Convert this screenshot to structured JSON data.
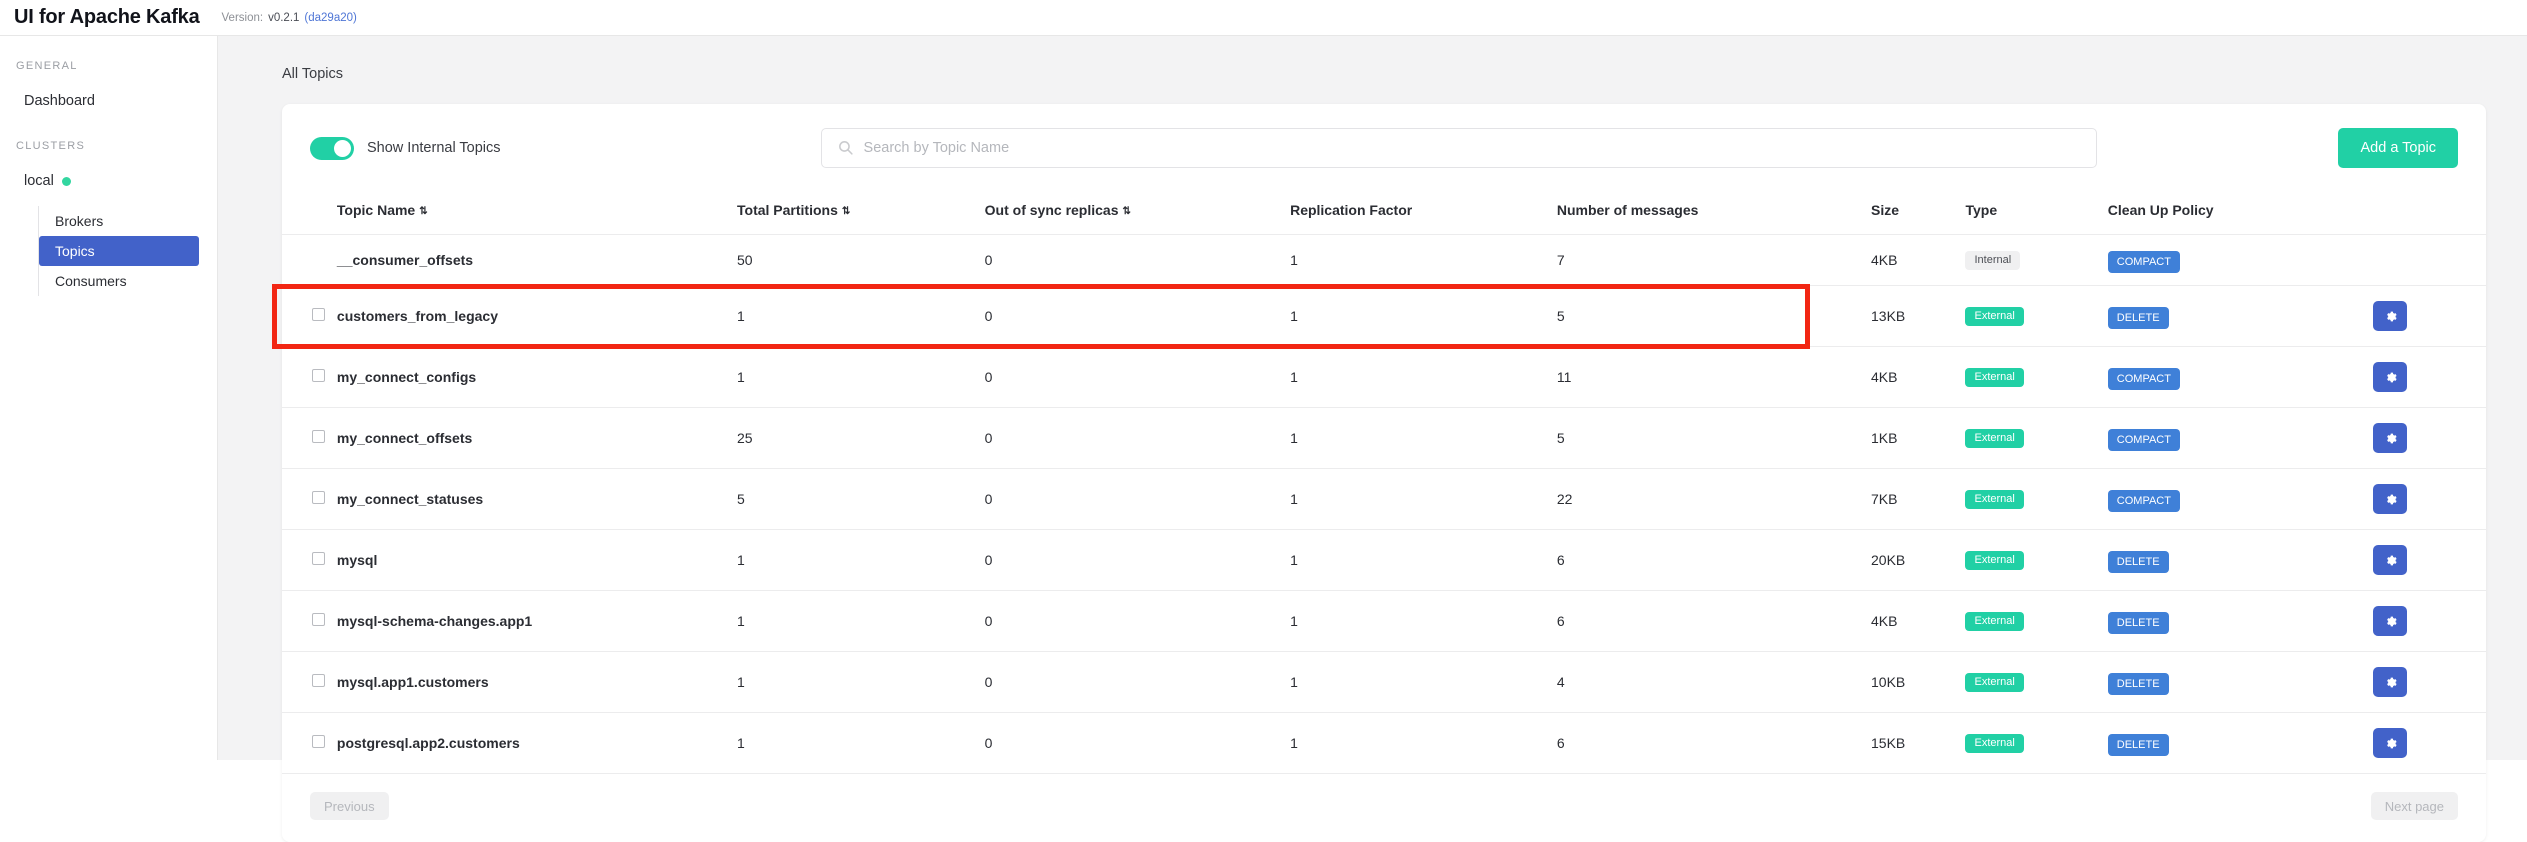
{
  "header": {
    "brand": "UI for Apache Kafka",
    "version_label": "Version:",
    "version_number": "v0.2.1",
    "version_hash": "(da29a20)"
  },
  "sidebar": {
    "general_heading": "GENERAL",
    "dashboard_label": "Dashboard",
    "clusters_heading": "CLUSTERS",
    "cluster_name": "local",
    "subnav": [
      {
        "label": "Brokers",
        "active": false
      },
      {
        "label": "Topics",
        "active": true
      },
      {
        "label": "Consumers",
        "active": false
      }
    ]
  },
  "main": {
    "page_title": "All Topics",
    "toggle_label": "Show Internal Topics",
    "toggle_on": true,
    "search_placeholder": "Search by Topic Name",
    "search_value": "",
    "add_topic_label": "Add a Topic",
    "previous_label": "Previous",
    "next_label": "Next page"
  },
  "table": {
    "columns": [
      "Topic Name",
      "Total Partitions",
      "Out of sync replicas",
      "Replication Factor",
      "Number of messages",
      "Size",
      "Type",
      "Clean Up Policy"
    ],
    "sortable": [
      true,
      true,
      true,
      false,
      false,
      false,
      false,
      false
    ],
    "rows": [
      {
        "checkbox": false,
        "name": "__consumer_offsets",
        "partitions": "50",
        "oos": "0",
        "replication": "1",
        "messages": "7",
        "size": "4KB",
        "type": "Internal",
        "policy": "COMPACT",
        "gear": false
      },
      {
        "checkbox": true,
        "name": "customers_from_legacy",
        "partitions": "1",
        "oos": "0",
        "replication": "1",
        "messages": "5",
        "size": "13KB",
        "type": "External",
        "policy": "DELETE",
        "gear": true
      },
      {
        "checkbox": true,
        "name": "my_connect_configs",
        "partitions": "1",
        "oos": "0",
        "replication": "1",
        "messages": "11",
        "size": "4KB",
        "type": "External",
        "policy": "COMPACT",
        "gear": true
      },
      {
        "checkbox": true,
        "name": "my_connect_offsets",
        "partitions": "25",
        "oos": "0",
        "replication": "1",
        "messages": "5",
        "size": "1KB",
        "type": "External",
        "policy": "COMPACT",
        "gear": true
      },
      {
        "checkbox": true,
        "name": "my_connect_statuses",
        "partitions": "5",
        "oos": "0",
        "replication": "1",
        "messages": "22",
        "size": "7KB",
        "type": "External",
        "policy": "COMPACT",
        "gear": true
      },
      {
        "checkbox": true,
        "name": "mysql",
        "partitions": "1",
        "oos": "0",
        "replication": "1",
        "messages": "6",
        "size": "20KB",
        "type": "External",
        "policy": "DELETE",
        "gear": true
      },
      {
        "checkbox": true,
        "name": "mysql-schema-changes.app1",
        "partitions": "1",
        "oos": "0",
        "replication": "1",
        "messages": "6",
        "size": "4KB",
        "type": "External",
        "policy": "DELETE",
        "gear": true
      },
      {
        "checkbox": true,
        "name": "mysql.app1.customers",
        "partitions": "1",
        "oos": "0",
        "replication": "1",
        "messages": "4",
        "size": "10KB",
        "type": "External",
        "policy": "DELETE",
        "gear": true
      },
      {
        "checkbox": true,
        "name": "postgresql.app2.customers",
        "partitions": "1",
        "oos": "0",
        "replication": "1",
        "messages": "6",
        "size": "15KB",
        "type": "External",
        "policy": "DELETE",
        "gear": true
      }
    ]
  },
  "annotation": {
    "highlight_row_index": 1,
    "highlight_color": "#f22613"
  },
  "colors": {
    "accent_green": "#21d0a5",
    "accent_blue": "#4262c9",
    "policy_blue": "#3f80d8",
    "online_dot": "#33d6a0"
  }
}
